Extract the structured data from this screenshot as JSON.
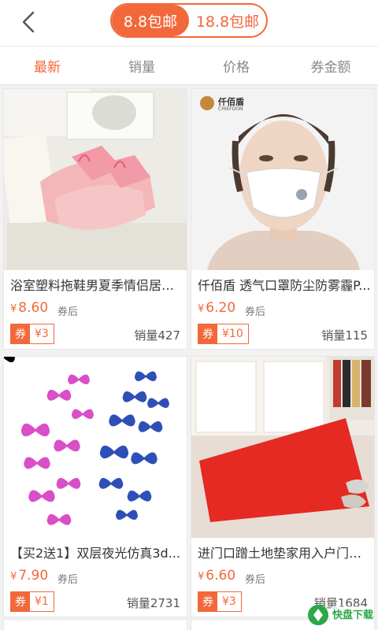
{
  "header": {
    "segments": [
      {
        "label": "8.8包邮",
        "active": true
      },
      {
        "label": "18.8包邮",
        "active": false
      }
    ]
  },
  "sort_tabs": [
    {
      "label": "最新",
      "active": true
    },
    {
      "label": "销量",
      "active": false
    },
    {
      "label": "价格",
      "active": false
    },
    {
      "label": "券金额",
      "active": false
    }
  ],
  "products": [
    {
      "title": "浴室塑料拖鞋男夏季情侣居家...",
      "yen": "¥",
      "price": "8.60",
      "after_label": "券后",
      "coupon_label": "券",
      "coupon": "¥3",
      "sales": "销量427"
    },
    {
      "title": "仟佰盾 透气口罩防尘防雾霾P...",
      "yen": "¥",
      "price": "6.20",
      "after_label": "券后",
      "coupon_label": "券",
      "coupon": "¥10",
      "sales": "销量115"
    },
    {
      "title": "【买2送1】双层夜光仿真3d...",
      "yen": "¥",
      "price": "7.90",
      "after_label": "券后",
      "coupon_label": "券",
      "coupon": "¥1",
      "sales": "销量2731"
    },
    {
      "title": "进门口蹭土地垫家用入户门厅...",
      "yen": "¥",
      "price": "6.60",
      "after_label": "券后",
      "coupon_label": "券",
      "coupon": "¥3",
      "sales": "销量1684"
    }
  ],
  "images": {
    "mask_brand": "仟佰盾",
    "mask_brand_sub": "CHIEFDON"
  },
  "watermark": {
    "text": "快盘下载"
  },
  "colors": {
    "accent": "#f2683a"
  }
}
